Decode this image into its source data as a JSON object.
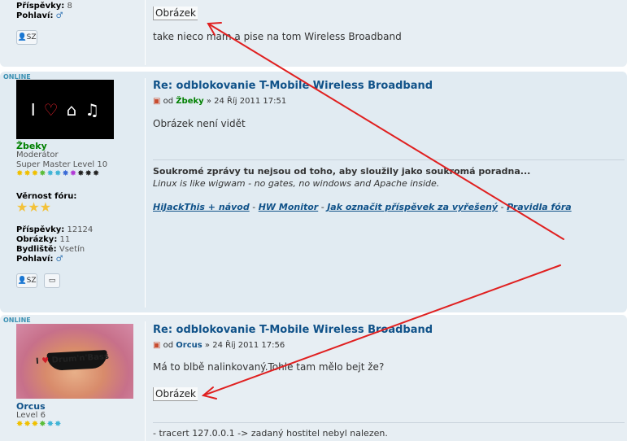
{
  "post1": {
    "prispevky_label": "Příspěvky:",
    "prispevky_value": "8",
    "pohlavi_label": "Pohlaví:",
    "pohlavi_icon": "male-symbol-icon",
    "pm_button": "SZ",
    "image_box": "Obrázek",
    "body": "take nieco mam a pise na tom Wireless Broadband"
  },
  "post2": {
    "online": "ONLINE",
    "avatar_text": "I ♡ ⌂ ♫",
    "username": "Žbeky",
    "rank1": "Moderátor",
    "rank2": "Super Master Level 10",
    "vernost_label": "Věrnost fóru:",
    "prispevky_label": "Příspěvky:",
    "prispevky_value": "12124",
    "obrazky_label": "Obrázky:",
    "obrazky_value": "11",
    "bydliste_label": "Bydliště:",
    "bydliste_value": "Vsetín",
    "pohlavi_label": "Pohlaví:",
    "pm_button": "SZ",
    "title": "Re: odblokovanie T-Mobile Wireless Broadband",
    "by": "od",
    "author": "Žbeky",
    "date": "» 24 Říj 2011 17:51",
    "body": "Obrázek není vidět",
    "sig_bold": "Soukromé zprávy tu nejsou od toho, aby sloužily jako soukromá poradna...",
    "sig_italic": "Linux is like wigwam - no gates, no windows and Apache inside.",
    "links": [
      "HiJackThis + návod",
      "HW Monitor",
      "Jak označit příspěvek za vyřešený",
      "Pravidla fóra"
    ],
    "link_sep": "-"
  },
  "post3": {
    "online": "ONLINE",
    "avatar_text": "I ♥ Drum'n'Bass",
    "username": "Orcus",
    "rank": "Level 6",
    "title": "Re: odblokovanie T-Mobile Wireless Broadband",
    "by": "od",
    "author": "Orcus",
    "date": "» 24 Říj 2011 17:56",
    "body": "Má to blbě nalinkovaný.Tohle tam mělo bejt že?",
    "image_box": "Obrázek",
    "sig": "- tracert 127.0.0.1 -> zadaný hostitel nebyl nalezen."
  },
  "colors": {
    "username_moderator": "#008000",
    "username_user": "#105289",
    "annotation_arrows": "#e02020"
  }
}
